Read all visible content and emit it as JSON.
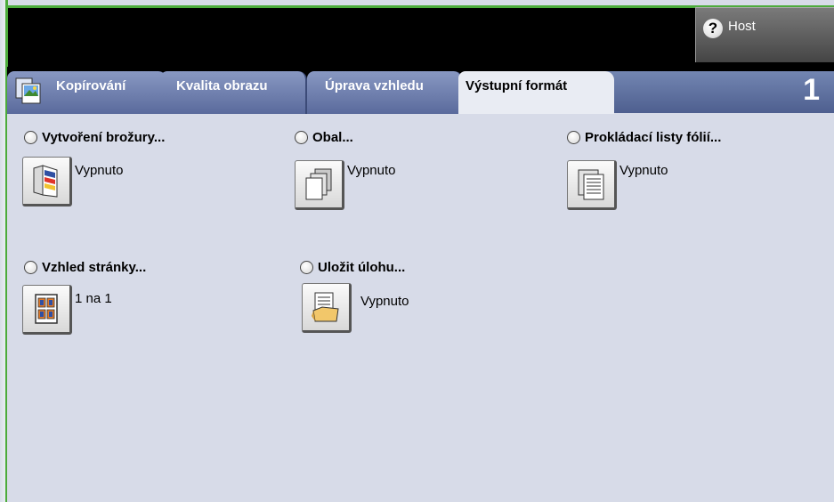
{
  "header": {
    "help_label": "Host"
  },
  "tabs": [
    {
      "label": "Kopírování"
    },
    {
      "label": "Kvalita obrazu"
    },
    {
      "label": "Úprava vzhledu"
    },
    {
      "label": "Výstupní formát"
    }
  ],
  "job_number": "1",
  "options": {
    "booklet": {
      "label": "Vytvoření brožury...",
      "value": "Vypnuto"
    },
    "cover": {
      "label": "Obal...",
      "value": "Vypnuto"
    },
    "transparency": {
      "label": "Prokládací listy fólií...",
      "value": "Vypnuto"
    },
    "page_layout": {
      "label": "Vzhled stránky...",
      "value": "1 na 1"
    },
    "save_job": {
      "label": "Uložit úlohu...",
      "value": "Vypnuto"
    }
  }
}
